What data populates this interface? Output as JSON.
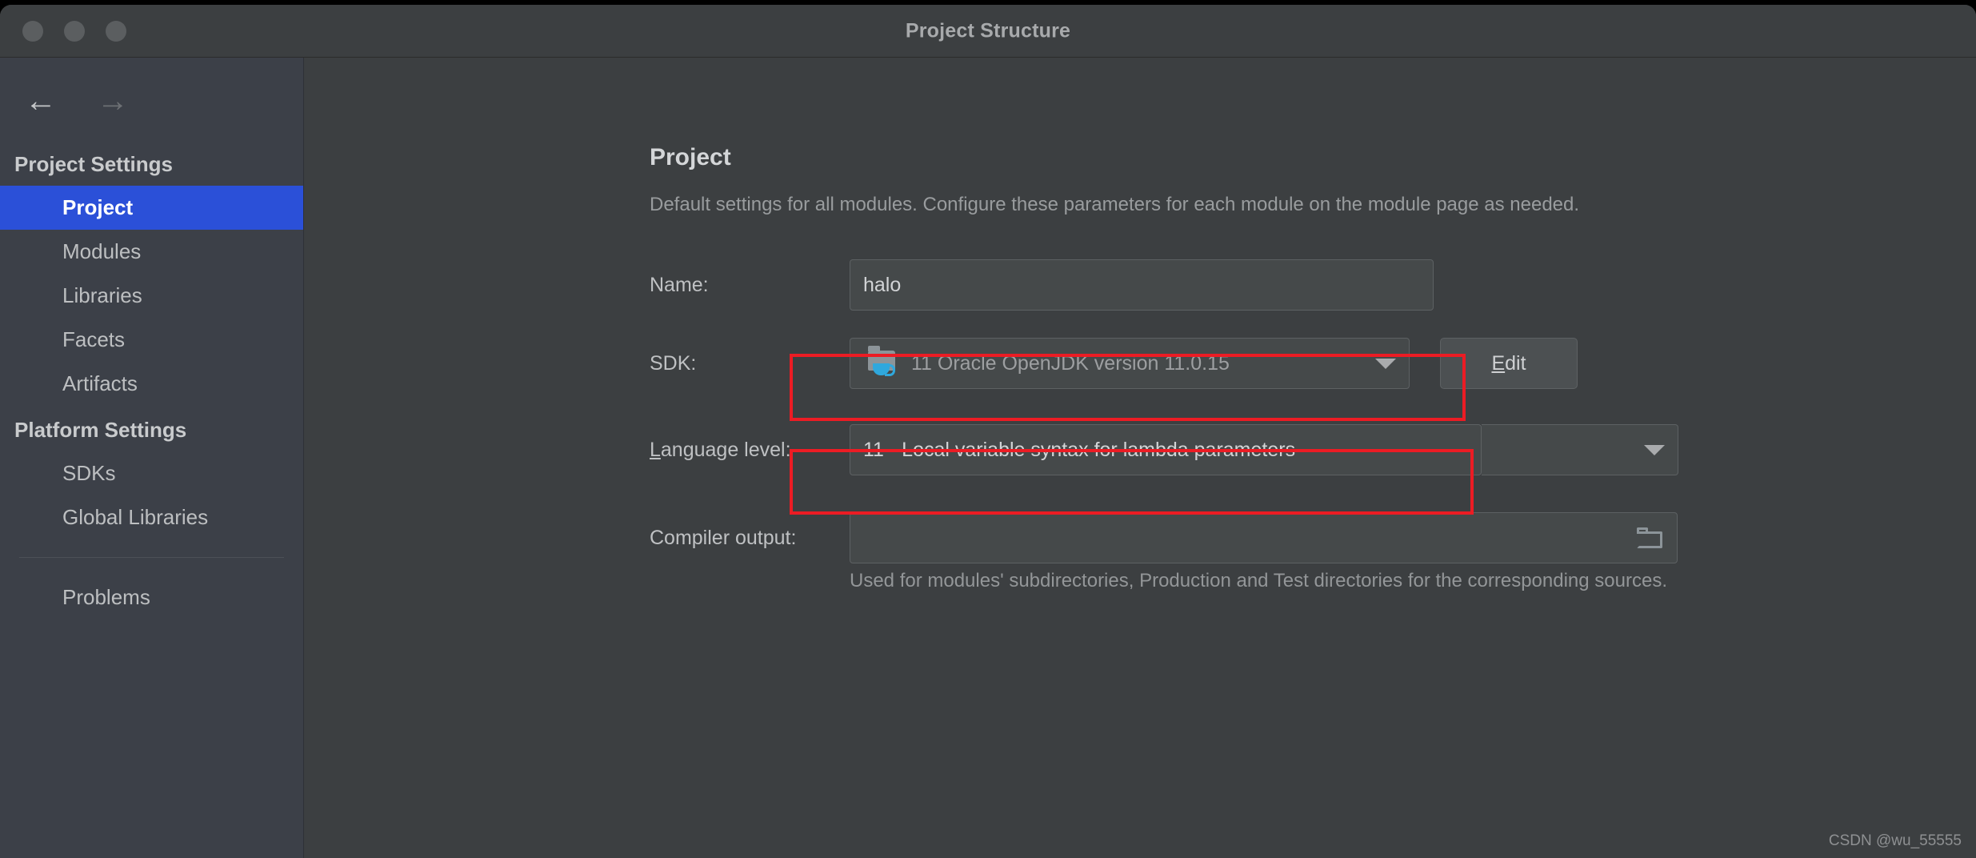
{
  "window": {
    "title": "Project Structure",
    "traffic_lights": [
      "close-button",
      "minimize-button",
      "maximize-button"
    ]
  },
  "nav": {
    "back_icon": "arrow-left-icon",
    "forward_icon": "arrow-right-icon"
  },
  "sidebar": {
    "sections": [
      {
        "header": "Project Settings",
        "items": [
          {
            "label": "Project",
            "selected": true
          },
          {
            "label": "Modules",
            "selected": false
          },
          {
            "label": "Libraries",
            "selected": false
          },
          {
            "label": "Facets",
            "selected": false
          },
          {
            "label": "Artifacts",
            "selected": false
          }
        ]
      },
      {
        "header": "Platform Settings",
        "items": [
          {
            "label": "SDKs",
            "selected": false
          },
          {
            "label": "Global Libraries",
            "selected": false
          }
        ]
      }
    ],
    "problems_label": "Problems"
  },
  "main": {
    "title": "Project",
    "description": "Default settings for all modules. Configure these parameters for each module on the module page as needed.",
    "fields": {
      "name": {
        "label": "Name:",
        "value": "halo"
      },
      "sdk": {
        "label": "SDK:",
        "value": "11 Oracle OpenJDK version 11.0.15",
        "icon": "jdk-folder-icon",
        "caret": "chevron-down-icon",
        "edit_button": "Edit",
        "edit_mnemonic": "E"
      },
      "language_level": {
        "label": "Language level:",
        "mnemonic": "L",
        "value": "11 - Local variable syntax for lambda parameters",
        "caret": "chevron-down-icon"
      },
      "compiler_output": {
        "label": "Compiler output:",
        "value": "",
        "placeholder": "",
        "browse_icon": "folder-browse-icon",
        "help": "Used for modules' subdirectories, Production and Test directories for the corresponding sources."
      }
    }
  },
  "annotations": {
    "accent_color": "#ec1c24",
    "boxes": [
      "sdk-highlight",
      "language-level-highlight"
    ]
  },
  "watermark": "CSDN @wu_55555"
}
